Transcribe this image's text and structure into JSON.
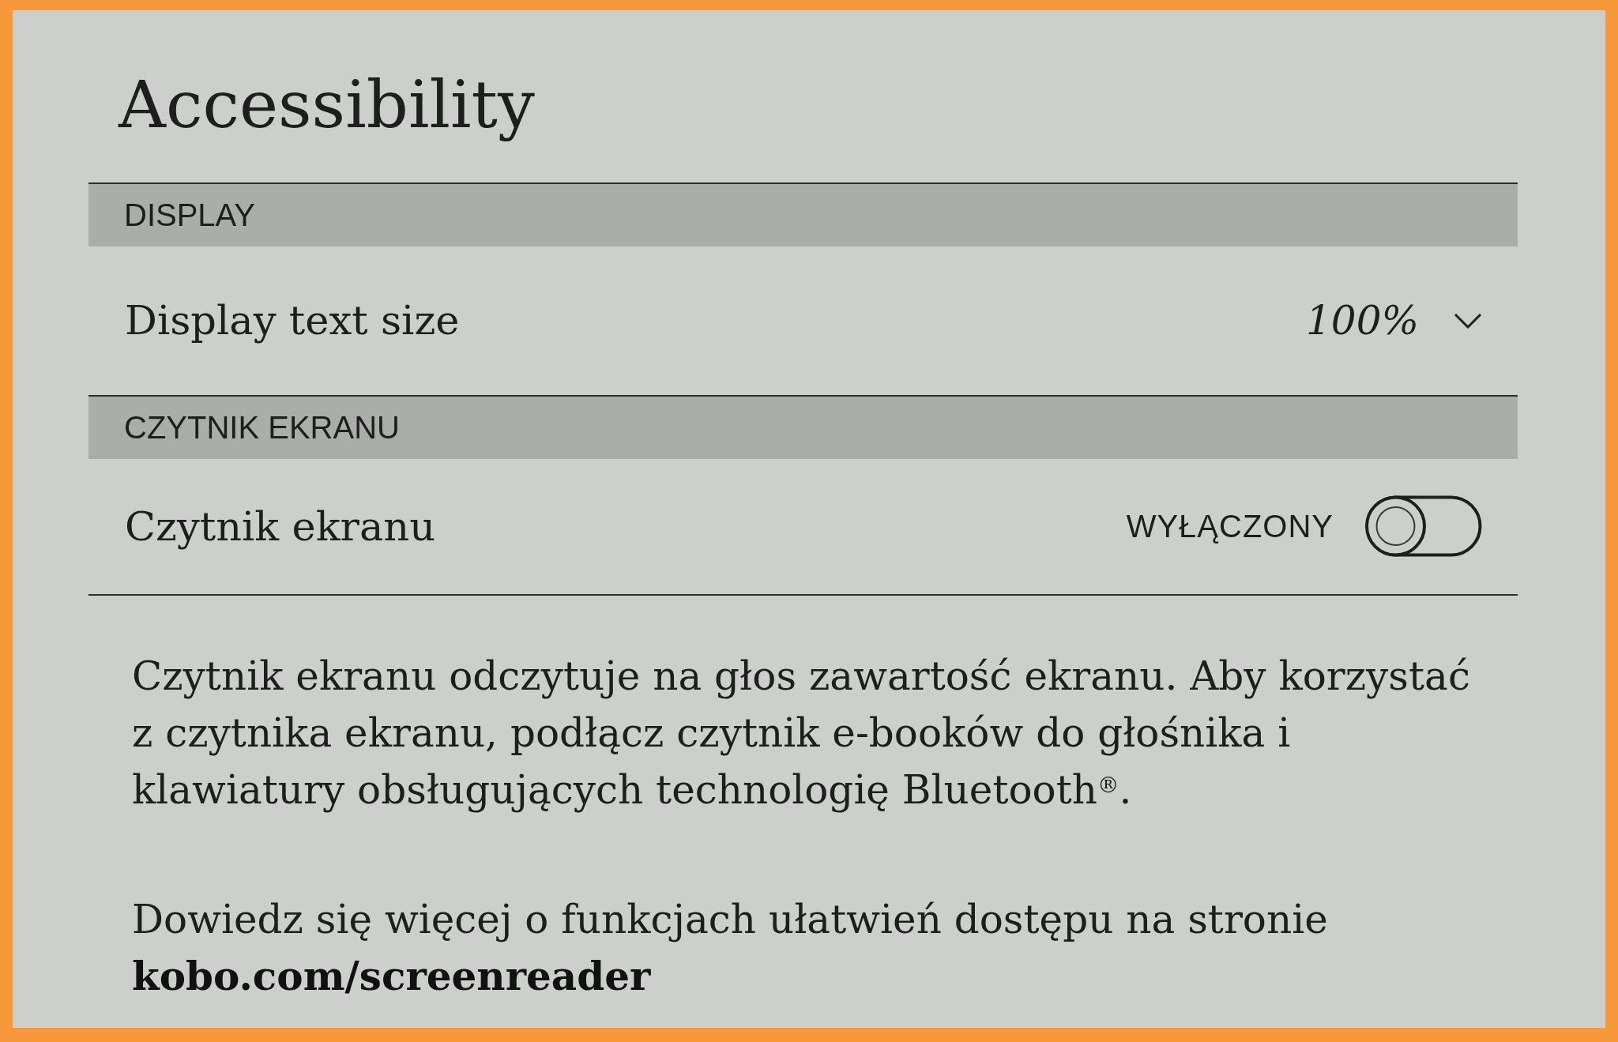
{
  "title": "Accessibility",
  "sections": [
    {
      "header": "DISPLAY",
      "rows": [
        {
          "kind": "dropdown",
          "label": "Display text size",
          "value": "100%"
        }
      ]
    },
    {
      "header": "CZYTNIK EKRANU",
      "rows": [
        {
          "kind": "toggle",
          "label": "Czytnik ekranu",
          "state_text": "WYŁĄCZONY",
          "on": false
        }
      ]
    }
  ],
  "description": "Czytnik ekranu odczytuje na głos zawartość ekranu. Aby korzystać z czytnika ekranu, podłącz czytnik e-booków do głośnika i klawiatury obsługujących technologię Bluetooth$^{®}$.",
  "more_info": {
    "text": "Dowiedz się więcej o funkcjach ułatwień dostępu na stronie",
    "link": "kobo.com/screenreader"
  }
}
